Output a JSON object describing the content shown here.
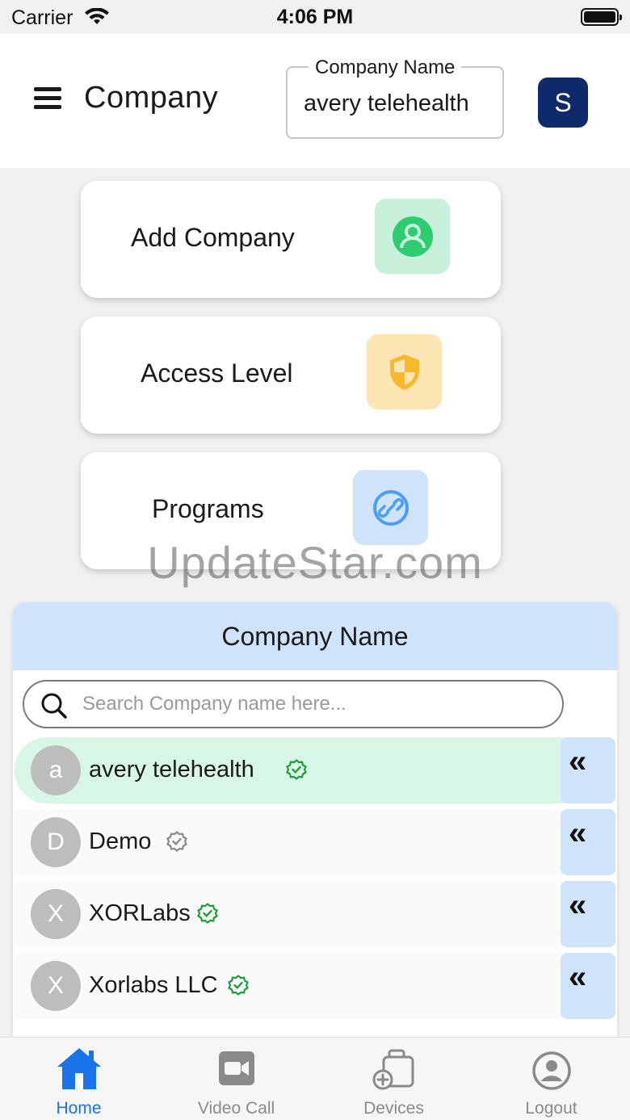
{
  "status_bar": {
    "carrier": "Carrier",
    "time": "4:06 PM"
  },
  "header": {
    "title": "Company",
    "company_field": {
      "label": "Company Name",
      "value": "avery telehealth"
    },
    "avatar_initial": "S"
  },
  "actions": [
    {
      "label": "Add Company",
      "icon": "user-circle-icon",
      "tile_color": "#c8f0da",
      "icon_color": "#2ecc71"
    },
    {
      "label": "Access Level",
      "icon": "shield-icon",
      "tile_color": "#fde5b3",
      "icon_color": "#f5b82e"
    },
    {
      "label": "Programs",
      "icon": "link-icon",
      "tile_color": "#cfe3fb",
      "icon_color": "#4a9ef5"
    }
  ],
  "watermark": "UpdateStar.com",
  "company_panel": {
    "title": "Company Name",
    "search_placeholder": "Search Company name here...",
    "companies": [
      {
        "initial": "a",
        "name": "avery telehealth",
        "verified": true,
        "selected": true
      },
      {
        "initial": "D",
        "name": "Demo",
        "verified": false,
        "selected": false
      },
      {
        "initial": "X",
        "name": "XORLabs",
        "verified": true,
        "selected": false
      },
      {
        "initial": "X",
        "name": "Xorlabs LLC",
        "verified": true,
        "selected": false
      }
    ],
    "expand_glyph": "«"
  },
  "tab_bar": {
    "tabs": [
      {
        "label": "Home",
        "icon": "home-icon",
        "active": true
      },
      {
        "label": "Video Call",
        "icon": "video-camera-icon",
        "active": false
      },
      {
        "label": "Devices",
        "icon": "devices-icon",
        "active": false
      },
      {
        "label": "Logout",
        "icon": "user-circle-icon",
        "active": false
      }
    ]
  },
  "colors": {
    "accent": "#1a73e8",
    "avatar_bg": "#0e2a6b",
    "selected_row": "#d9f7e6",
    "verified_green": "#1e9e3a",
    "unverified_gray": "#8a8a8a"
  }
}
